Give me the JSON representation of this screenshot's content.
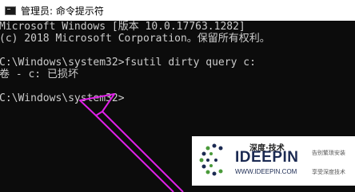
{
  "window": {
    "title": "管理员: 命令提示符",
    "icon": "console-icon"
  },
  "console": {
    "lines": [
      "Microsoft Windows [版本 10.0.17763.1282]",
      "(c) 2018 Microsoft Corporation。保留所有权利。",
      "",
      "C:\\Windows\\system32>fsutil dirty query c:",
      "卷 - c: 已损坏",
      "",
      "C:\\Windows\\system32>"
    ]
  },
  "annotation": {
    "color": "#e020e8",
    "icon": "arrow-annotation"
  },
  "watermark": {
    "cn_brand": "深度·技术",
    "brand": "IDEEPIN",
    "url": "WWW.IDEEPIN.COM",
    "tagline_1": "告别繁琐安装",
    "tagline_2": "享受深度技术",
    "icon": "ideepin-logo-icon"
  }
}
